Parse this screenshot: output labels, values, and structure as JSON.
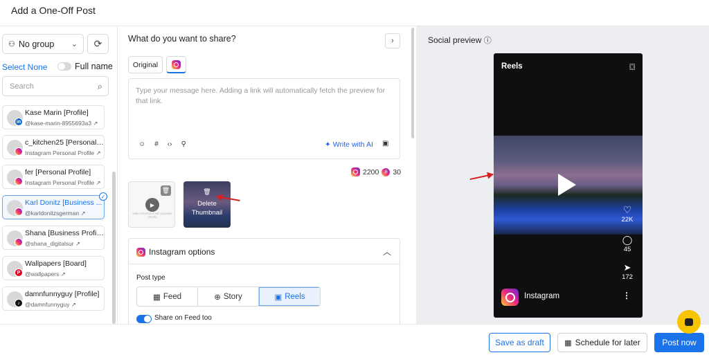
{
  "header": {
    "title": "Add a One-Off Post"
  },
  "sidebar": {
    "group_select": "No group",
    "select_none": "Select None",
    "full_name_label": "Full name",
    "search_placeholder": "Search",
    "accounts": [
      {
        "name": "Kase Marin [Profile]",
        "sub": "@kase-marin-8955693a3",
        "network": "linkedin",
        "badge": "in",
        "badge_color": "#0a66c2",
        "selected": false
      },
      {
        "name": "c_kitchen25 [Personal ...",
        "sub": "Instagram Personal Profile",
        "network": "instagram",
        "badge": "",
        "badge_color": "#e1306c",
        "selected": false
      },
      {
        "name": "fer [Personal Profile]",
        "sub": "Instagram Personal Profile",
        "network": "instagram",
        "badge": "",
        "badge_color": "#e1306c",
        "selected": false
      },
      {
        "name": "Karl Donitz [Business ...",
        "sub": "@karldonitzsgerman",
        "network": "instagram",
        "badge": "",
        "badge_color": "#e1306c",
        "selected": true
      },
      {
        "name": "Shana [Business Profile]",
        "sub": "@shana_digitalsur",
        "network": "instagram",
        "badge": "",
        "badge_color": "#e1306c",
        "selected": false
      },
      {
        "name": "Wallpapers [Board]",
        "sub": "@wallpapers",
        "network": "pinterest",
        "badge": "P",
        "badge_color": "#e60023",
        "selected": false
      },
      {
        "name": "damnfunnyguy [Profile]",
        "sub": "@damnfunnyguy",
        "network": "tiktok",
        "badge": "♪",
        "badge_color": "#111111",
        "selected": false
      }
    ]
  },
  "composer": {
    "question": "What do you want to share?",
    "tab_original": "Original",
    "message_placeholder": "Type your message here. Adding a link will automatically fetch the preview for that link.",
    "write_ai": "Write with AI",
    "char_count": "2200",
    "hashtag_count": "30",
    "media_caption": "video thumbnail will populate shortly",
    "delete_thumbnail": "Delete Thumbnail",
    "ig_options_title": "Instagram options",
    "post_type_label": "Post type",
    "post_types": [
      "Feed",
      "Story",
      "Reels"
    ],
    "post_type_active": "Reels",
    "share_feed_label": "Share on Feed too"
  },
  "preview": {
    "title": "Social preview",
    "reels_label": "Reels",
    "likes": "22K",
    "comments": "45",
    "shares": "172",
    "account": "Instagram"
  },
  "footer": {
    "save_draft": "Save as draft",
    "schedule": "Schedule for later",
    "post_now": "Post now"
  },
  "colors": {
    "accent": "#1a73e8",
    "annotation_arrow": "#d62020"
  }
}
